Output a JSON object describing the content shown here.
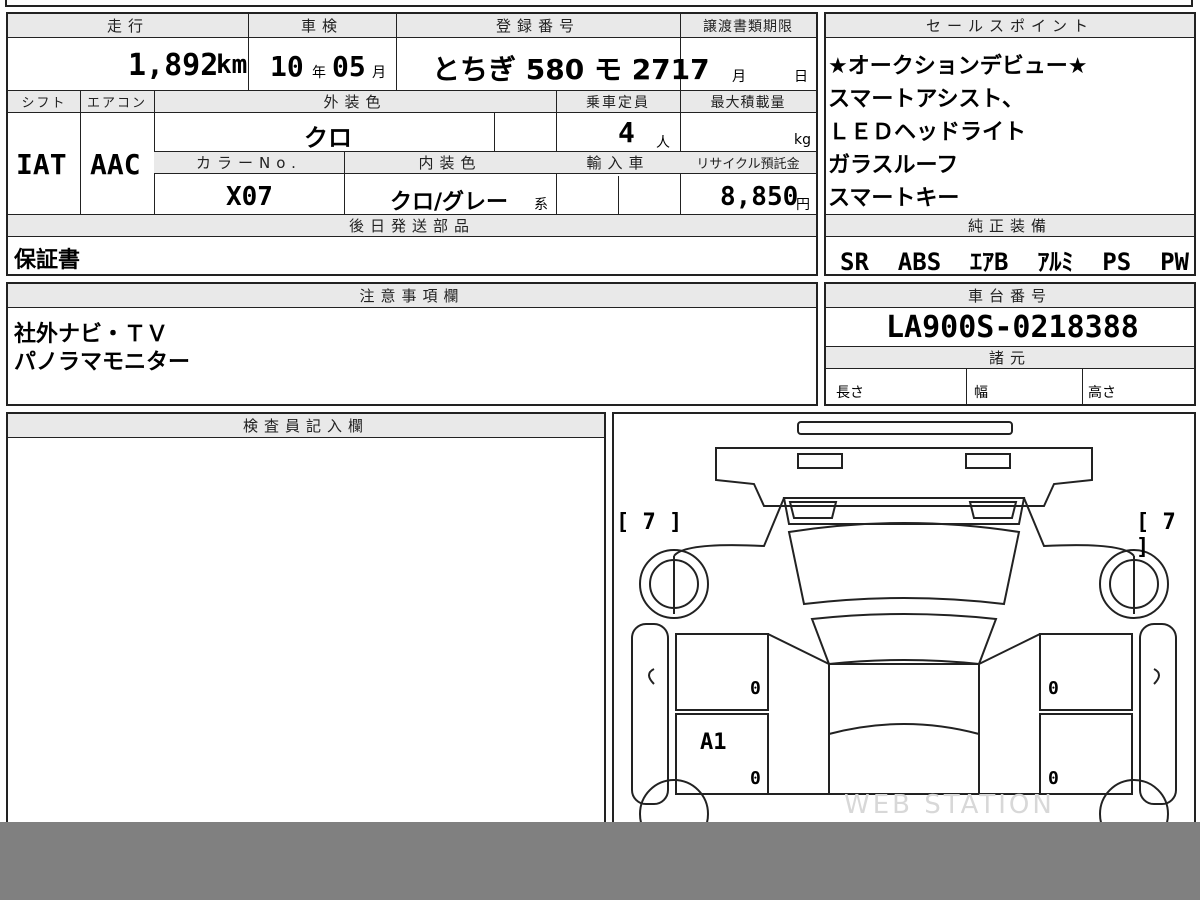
{
  "top_row": {
    "mileage": {
      "header": "走行",
      "value": "1,892",
      "unit": "km"
    },
    "inspection": {
      "header": "車検",
      "year": "10",
      "year_unit": "年",
      "month": "05",
      "month_unit": "月"
    },
    "registration": {
      "header": "登録番号",
      "value": "とちぎ 580 モ 2717"
    },
    "transfer_deadline": {
      "header": "譲渡書類期限",
      "month_unit": "月",
      "day_unit": "日"
    }
  },
  "second_row": {
    "shift": {
      "header": "シフト",
      "value": "IAT"
    },
    "aircon": {
      "header": "エアコン",
      "value": "AAC"
    },
    "exterior_color": {
      "header": "外装色",
      "value": "クロ"
    },
    "capacity": {
      "header": "乗車定員",
      "value": "4",
      "unit": "人"
    },
    "max_load": {
      "header": "最大積載量",
      "unit": "kg"
    },
    "color_no": {
      "header": "カラーNo.",
      "value": "X07"
    },
    "interior_color": {
      "header": "内装色",
      "value": "クロ/グレー",
      "suffix": "系"
    },
    "import": {
      "header": "輸入車"
    },
    "recycle_fee": {
      "header": "リサイクル預託金",
      "value": "8,850",
      "unit": "円"
    }
  },
  "later_parts": {
    "header": "後日発送部品",
    "value": "保証書"
  },
  "sales_points": {
    "header": "セールスポイント",
    "lines": [
      "★オークションデビュー★",
      "スマートアシスト、",
      "ＬＥＤヘッドライト",
      "ガラスルーフ",
      "スマートキー"
    ]
  },
  "genuine_equipment": {
    "header": "純正装備",
    "value": "SR  ABS  ｴｱB  ｱﾙﾐ  PS  PW"
  },
  "notes": {
    "header": "注意事項欄",
    "lines": [
      "社外ナビ・ＴＶ",
      "パノラマモニター"
    ]
  },
  "chassis": {
    "header": "車台番号",
    "value": "LA900S-0218388"
  },
  "specs": {
    "header": "諸元",
    "length": "長さ",
    "width": "幅",
    "height": "高さ"
  },
  "inspector": {
    "header": "検査員記入欄"
  },
  "diagram": {
    "left_tire": "[ 7 ]",
    "right_tire": "[ 7 ]",
    "mark_a1": "A1",
    "zero_marks": [
      "0",
      "0",
      "0",
      "0"
    ],
    "watermark": "WEB STATION"
  }
}
